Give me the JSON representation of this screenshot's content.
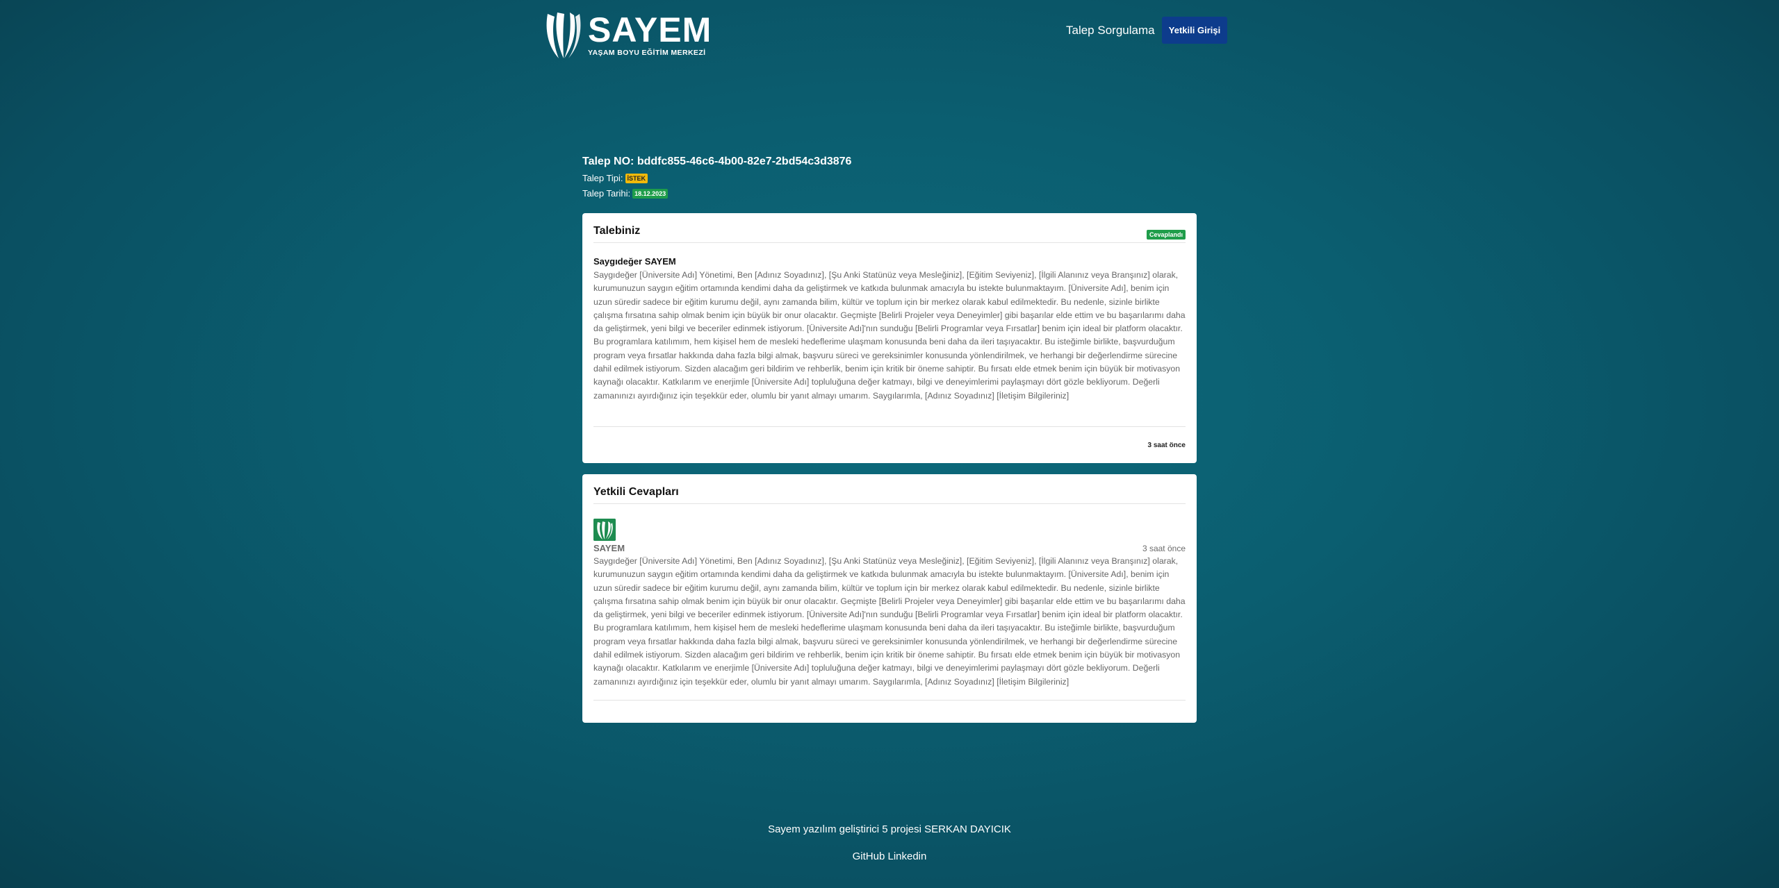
{
  "header": {
    "logo_title": "SAYEM",
    "logo_subtitle": "YAŞAM BOYU EĞİTİM MERKEZİ",
    "nav_link": "Talep Sorgulama",
    "login_label": "Yetkili Girişi"
  },
  "request": {
    "number_label": "Talep NO: bddfc855-46c6-4b00-82e7-2bd54c3d3876",
    "type_label": "Talep Tipi:",
    "type_value": "İSTEK",
    "date_label": "Talep Tarihi:",
    "date_value": "18.12.2023"
  },
  "request_card": {
    "title": "Talebiniz",
    "status": "Cevaplandı",
    "greeting": "Saygıdeğer SAYEM",
    "body": "Saygıdeğer [Üniversite Adı] Yönetimi, Ben [Adınız Soyadınız], [Şu Anki Statünüz veya Mesleğiniz], [Eğitim Seviyeniz], [İlgili Alanınız veya Branşınız] olarak, kurumunuzun saygın eğitim ortamında kendimi daha da geliştirmek ve katkıda bulunmak amacıyla bu istekte bulunmaktayım. [Üniversite Adı], benim için uzun süredir sadece bir eğitim kurumu değil, aynı zamanda bilim, kültür ve toplum için bir merkez olarak kabul edilmektedir. Bu nedenle, sizinle birlikte çalışma fırsatına sahip olmak benim için büyük bir onur olacaktır. Geçmişte [Belirli Projeler veya Deneyimler] gibi başarılar elde ettim ve bu başarılarımı daha da geliştirmek, yeni bilgi ve beceriler edinmek istiyorum. [Üniversite Adı]'nın sunduğu [Belirli Programlar veya Fırsatlar] benim için ideal bir platform olacaktır. Bu programlara katılımım, hem kişisel hem de mesleki hedeflerime ulaşmam konusunda beni daha da ileri taşıyacaktır. Bu isteğimle birlikte, başvurduğum program veya fırsatlar hakkında daha fazla bilgi almak, başvuru süreci ve gereksinimler konusunda yönlendirilmek, ve herhangi bir değerlendirme sürecine dahil edilmek istiyorum. Sizden alacağım geri bildirim ve rehberlik, benim için kritik bir öneme sahiptir. Bu fırsatı elde etmek benim için büyük bir motivasyon kaynağı olacaktır. Katkılarım ve enerjimle [Üniversite Adı] topluluğuna değer katmayı, bilgi ve deneyimlerimi paylaşmayı dört gözle bekliyorum. Değerli zamanınızı ayırdığınız için teşekkür eder, olumlu bir yanıt almayı umarım. Saygılarımla, [Adınız Soyadınız] [İletişim Bilgileriniz]",
    "time": "3 saat önce"
  },
  "responses_card": {
    "title": "Yetkili Cevapları",
    "responder": "SAYEM",
    "time": "3 saat önce",
    "body": "Saygıdeğer [Üniversite Adı] Yönetimi, Ben [Adınız Soyadınız], [Şu Anki Statünüz veya Mesleğiniz], [Eğitim Seviyeniz], [İlgili Alanınız veya Branşınız] olarak, kurumunuzun saygın eğitim ortamında kendimi daha da geliştirmek ve katkıda bulunmak amacıyla bu istekte bulunmaktayım. [Üniversite Adı], benim için uzun süredir sadece bir eğitim kurumu değil, aynı zamanda bilim, kültür ve toplum için bir merkez olarak kabul edilmektedir. Bu nedenle, sizinle birlikte çalışma fırsatına sahip olmak benim için büyük bir onur olacaktır. Geçmişte [Belirli Projeler veya Deneyimler] gibi başarılar elde ettim ve bu başarılarımı daha da geliştirmek, yeni bilgi ve beceriler edinmek istiyorum. [Üniversite Adı]'nın sunduğu [Belirli Programlar veya Fırsatlar] benim için ideal bir platform olacaktır. Bu programlara katılımım, hem kişisel hem de mesleki hedeflerime ulaşmam konusunda beni daha da ileri taşıyacaktır. Bu isteğimle birlikte, başvurduğum program veya fırsatlar hakkında daha fazla bilgi almak, başvuru süreci ve gereksinimler konusunda yönlendirilmek, ve herhangi bir değerlendirme sürecine dahil edilmek istiyorum. Sizden alacağım geri bildirim ve rehberlik, benim için kritik bir öneme sahiptir. Bu fırsatı elde etmek benim için büyük bir motivasyon kaynağı olacaktır. Katkılarım ve enerjimle [Üniversite Adı] topluluğuna değer katmayı, bilgi ve deneyimlerimi paylaşmayı dört gözle bekliyorum. Değerli zamanınızı ayırdığınız için teşekkür eder, olumlu bir yanıt almayı umarım. Saygılarımla, [Adınız Soyadınız] [İletişim Bilgileriniz]"
  },
  "footer": {
    "credit": "Sayem yazılım geliştirici 5 projesi SERKAN DAYICIK",
    "github": "GitHub",
    "linkedin": "Linkedin"
  }
}
